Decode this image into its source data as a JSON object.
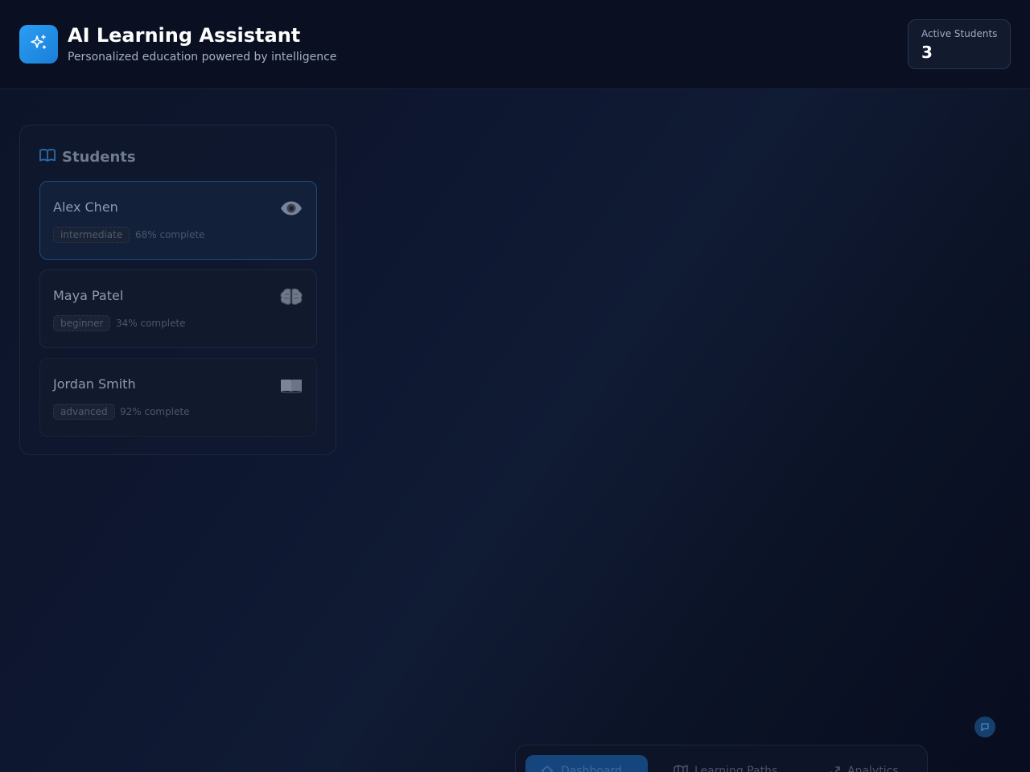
{
  "header": {
    "logo_icon": "sparkles-icon",
    "title": "AI Learning Assistant",
    "subtitle": "Personalized education powered by intelligence",
    "stat": {
      "label": "Active Students",
      "value": "3"
    }
  },
  "students_panel": {
    "title": "Students",
    "title_icon": "book-open-icon",
    "items": [
      {
        "name": "Alex Chen",
        "level": "intermediate",
        "progress": "68% complete",
        "progress_fraction": 0.68,
        "icon": "eye-icon",
        "active": true
      },
      {
        "name": "Maya Patel",
        "level": "beginner",
        "progress": "34% complete",
        "progress_fraction": 0.34,
        "icon": "brain-icon",
        "active": false
      },
      {
        "name": "Jordan Smith",
        "level": "advanced",
        "progress": "92% complete",
        "progress_fraction": 0.92,
        "icon": "book-icon",
        "active": false
      }
    ]
  },
  "fab": {
    "icon": "chat-icon"
  },
  "bottom_nav": {
    "items": [
      {
        "label": "Dashboard",
        "icon": "home-icon",
        "active": true
      },
      {
        "label": "Learning Paths",
        "icon": "map-icon",
        "active": false
      },
      {
        "label": "Analytics",
        "icon": "chart-icon",
        "active": false
      }
    ]
  },
  "colors": {
    "accent": "#2a9df4",
    "background": "#0c1428",
    "active_border": "#1f4a78"
  }
}
